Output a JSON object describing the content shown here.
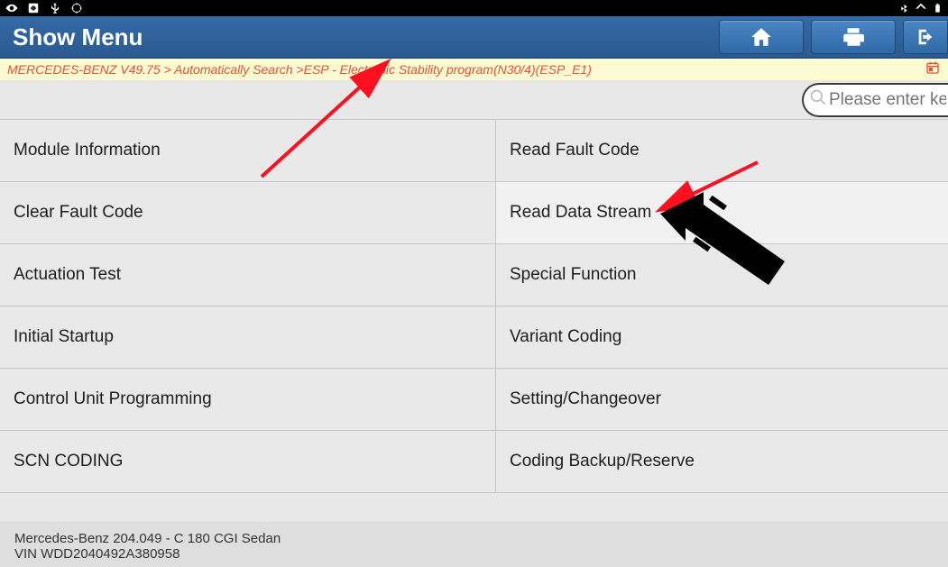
{
  "status_bar": {
    "left_icons": [
      "eye",
      "box-arrows",
      "usb",
      "target"
    ],
    "right_icons": [
      "bluetooth",
      "wifi",
      "battery"
    ]
  },
  "header": {
    "title": "Show Menu"
  },
  "breadcrumb": "MERCEDES-BENZ V49.75 > Automatically Search >ESP - Electronic Stability program(N30/4)(ESP_E1)",
  "search": {
    "placeholder": "Please enter key"
  },
  "menu": {
    "items": [
      {
        "label": "Module Information"
      },
      {
        "label": "Read Fault Code"
      },
      {
        "label": "Clear Fault Code"
      },
      {
        "label": "Read Data Stream"
      },
      {
        "label": "Actuation Test"
      },
      {
        "label": "Special Function"
      },
      {
        "label": "Initial Startup"
      },
      {
        "label": "Variant Coding"
      },
      {
        "label": "Control Unit Programming"
      },
      {
        "label": "Setting/Changeover"
      },
      {
        "label": "SCN CODING"
      },
      {
        "label": "Coding Backup/Reserve"
      }
    ]
  },
  "footer": {
    "line1": "Mercedes-Benz 204.049 - C 180 CGI Sedan",
    "line2": "VIN WDD2040492A380958"
  },
  "annotations": {
    "red_arrow_breadcrumb_target": "breadcrumb-esp",
    "red_arrow_item_target": "menu-item-read-data-stream",
    "black_arrow_target": "menu-item-read-data-stream"
  }
}
